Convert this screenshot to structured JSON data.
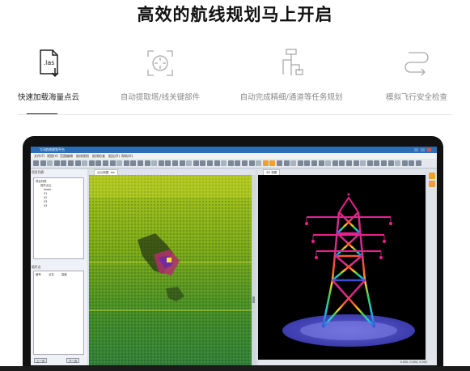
{
  "headline": "高效的航线规划马上开启",
  "features": [
    {
      "label": "快速加载海量点云",
      "icon": "las-file-icon",
      "active": true
    },
    {
      "label": "自动提取塔/线关键部件",
      "icon": "target-scan-icon",
      "active": false
    },
    {
      "label": "自动完成精细/通道等任务规划",
      "icon": "route-diagram-icon",
      "active": false
    },
    {
      "label": "模拟飞行安全检查",
      "icon": "flight-path-icon",
      "active": false
    }
  ],
  "las_icon_text": ".las",
  "app": {
    "window_title": "飞马航线规划平台",
    "menus": [
      "文件(F)",
      "视图(V)",
      "范围编辑",
      "航线规划",
      "航线检查",
      "报告(R)",
      "帮助(H)"
    ],
    "left_panel_title": "项目列表",
    "tree_root": "项目列表",
    "tree_items": [
      "塔杆点云",
      "tower",
      "01",
      "02",
      "03",
      "04"
    ],
    "table_title": "塔杆点",
    "table_headers": [
      "编号",
      "点名",
      "高度"
    ],
    "buttons": [
      "上一页",
      "下一页"
    ],
    "viewport1_tab": "点云视图 .las",
    "viewport2_tab": "3D 视图",
    "status_text": "0.000, 0.000, 0.000"
  },
  "colors": {
    "accent_orange": "#f0a030",
    "titlebar_blue": "#2a6fb5",
    "label_gray": "#888888"
  }
}
